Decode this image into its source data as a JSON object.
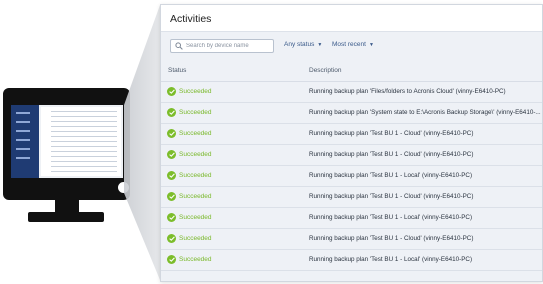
{
  "activities": {
    "title": "Activities",
    "search": {
      "placeholder": "Search by device name",
      "value": ""
    },
    "filters": {
      "status": "Any status",
      "sort": "Most recent"
    },
    "columns": {
      "status": "Status",
      "description": "Description"
    },
    "rows": [
      {
        "status": "Succeeded",
        "description": "Running backup plan 'Files/folders to Acronis Cloud' (vinny-E6410-PC)"
      },
      {
        "status": "Succeeded",
        "description": "Running backup plan 'System state to E:\\Acronis Backup Storage\\' (vinny-E6410-..."
      },
      {
        "status": "Succeeded",
        "description": "Running backup plan 'Test BU 1 - Cloud' (vinny-E6410-PC)"
      },
      {
        "status": "Succeeded",
        "description": "Running backup plan 'Test BU 1 - Cloud' (vinny-E6410-PC)"
      },
      {
        "status": "Succeeded",
        "description": "Running backup plan 'Test BU 1 - Local' (vinny-E6410-PC)"
      },
      {
        "status": "Succeeded",
        "description": "Running backup plan 'Test BU 1 - Cloud' (vinny-E6410-PC)"
      },
      {
        "status": "Succeeded",
        "description": "Running backup plan 'Test BU 1 - Local' (vinny-E6410-PC)"
      },
      {
        "status": "Succeeded",
        "description": "Running backup plan 'Test BU 1 - Cloud' (vinny-E6410-PC)"
      },
      {
        "status": "Succeeded",
        "description": "Running backup plan 'Test BU 1 - Local' (vinny-E6410-PC)"
      }
    ]
  },
  "icons": {
    "search": "search-icon",
    "status_succeeded": "check-circle-icon",
    "dropdown": "chevron-down-icon"
  },
  "colors": {
    "succeeded": "#7cbd2b",
    "link": "#3a5a8a",
    "sidebar": "#1f3b73",
    "monitor": "#111111"
  }
}
